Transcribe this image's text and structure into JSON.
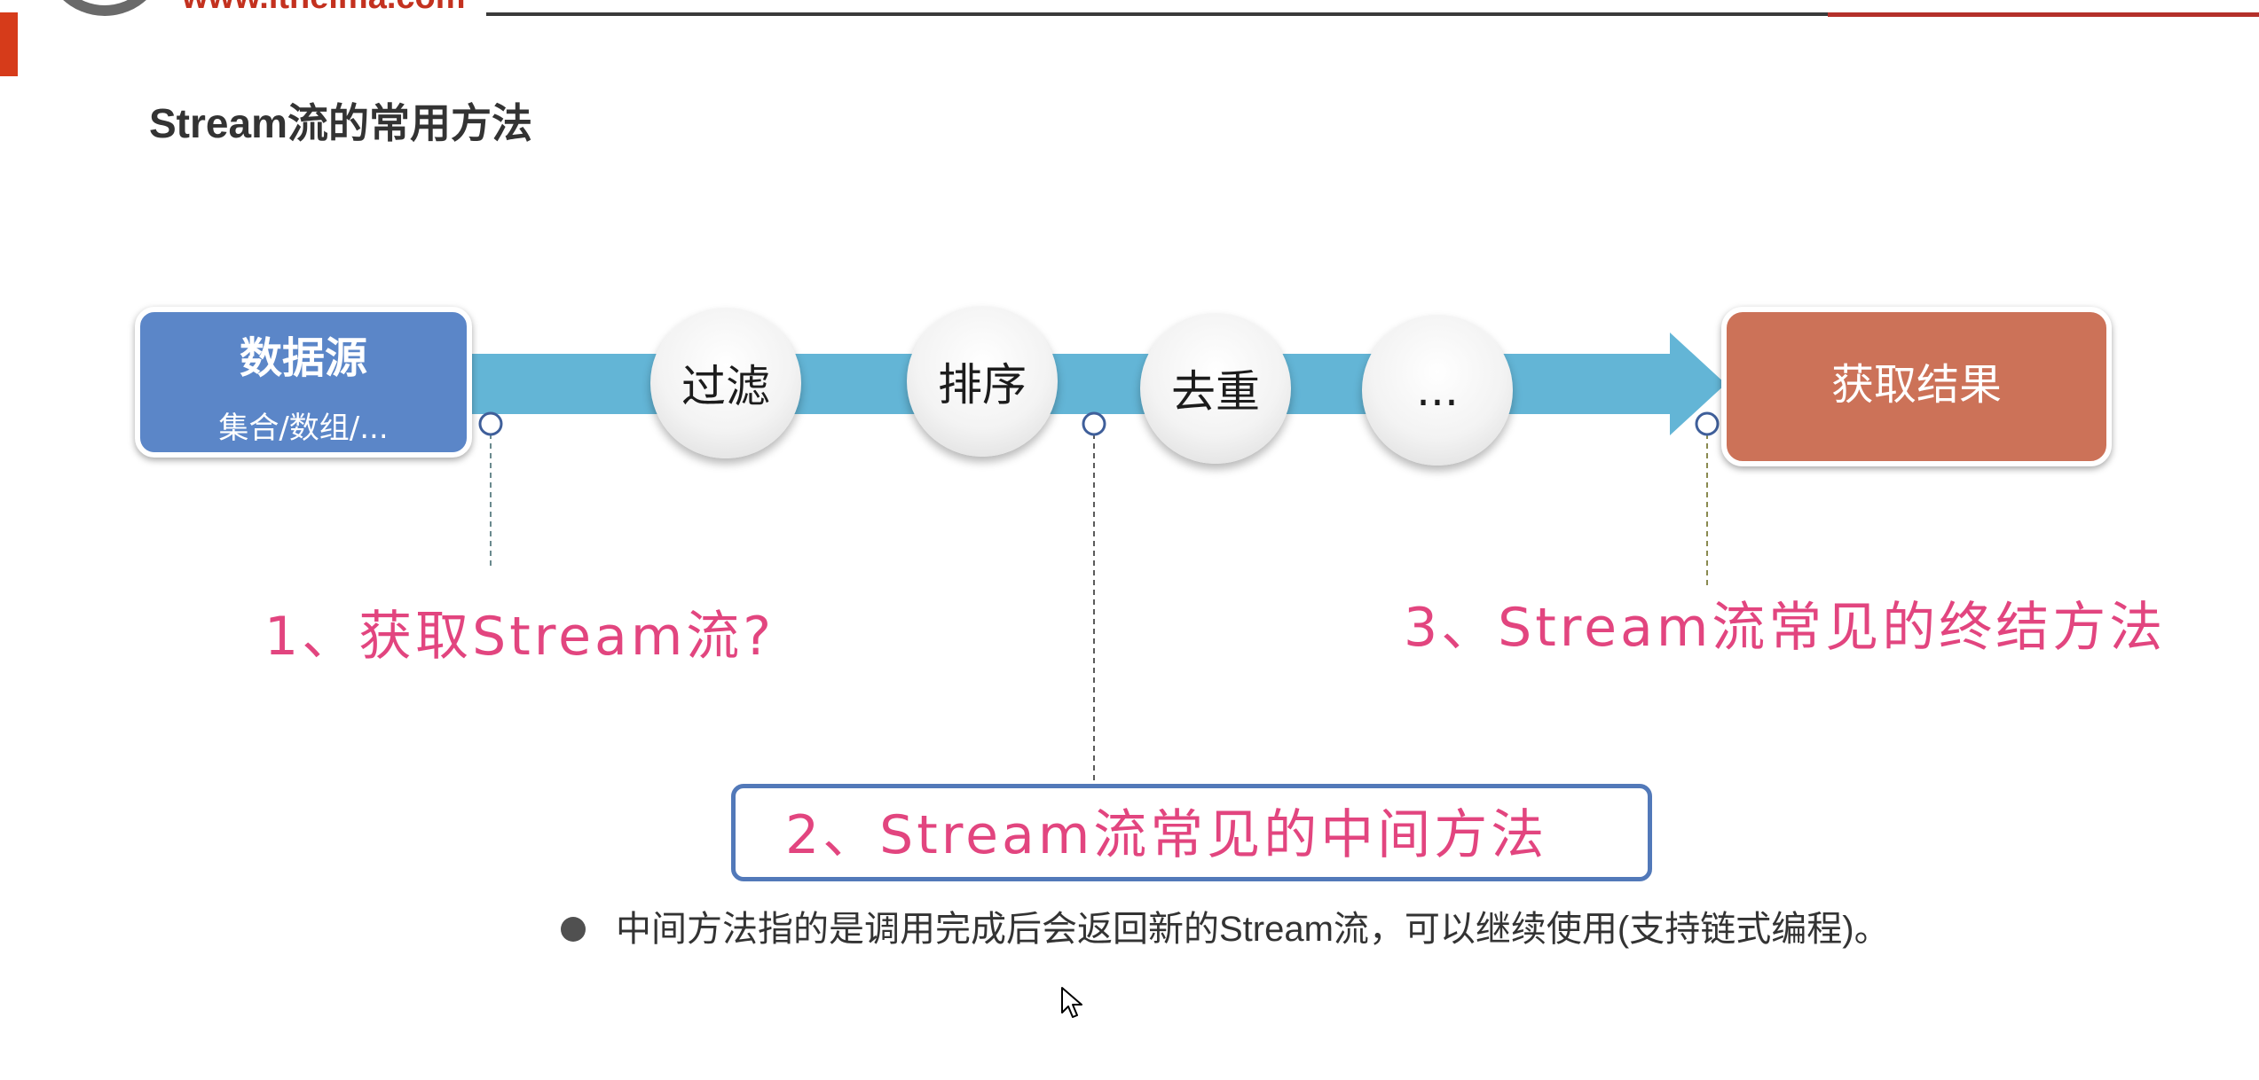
{
  "header": {
    "logo_url": "www.itheima.com"
  },
  "page": {
    "title": "Stream流的常用方法"
  },
  "flow": {
    "source": {
      "title": "数据源",
      "subtitle": "集合/数组/..."
    },
    "operations": [
      "过滤",
      "排序",
      "去重",
      "..."
    ],
    "result": "获取结果"
  },
  "annotations": {
    "step1": "1、获取Stream流?",
    "step2": "2、Stream流常见的中间方法",
    "step3": "3、Stream流常见的终结方法"
  },
  "bullet": {
    "text": "中间方法指的是调用完成后会返回新的Stream流，可以继续使用(支持链式编程)。"
  },
  "colors": {
    "arrow": "#63b5d6",
    "source_box": "#5b86c8",
    "result_box": "#cc7258",
    "annotation": "#e2457f",
    "box_border": "#5279b9",
    "header_red": "#d63b1a"
  }
}
